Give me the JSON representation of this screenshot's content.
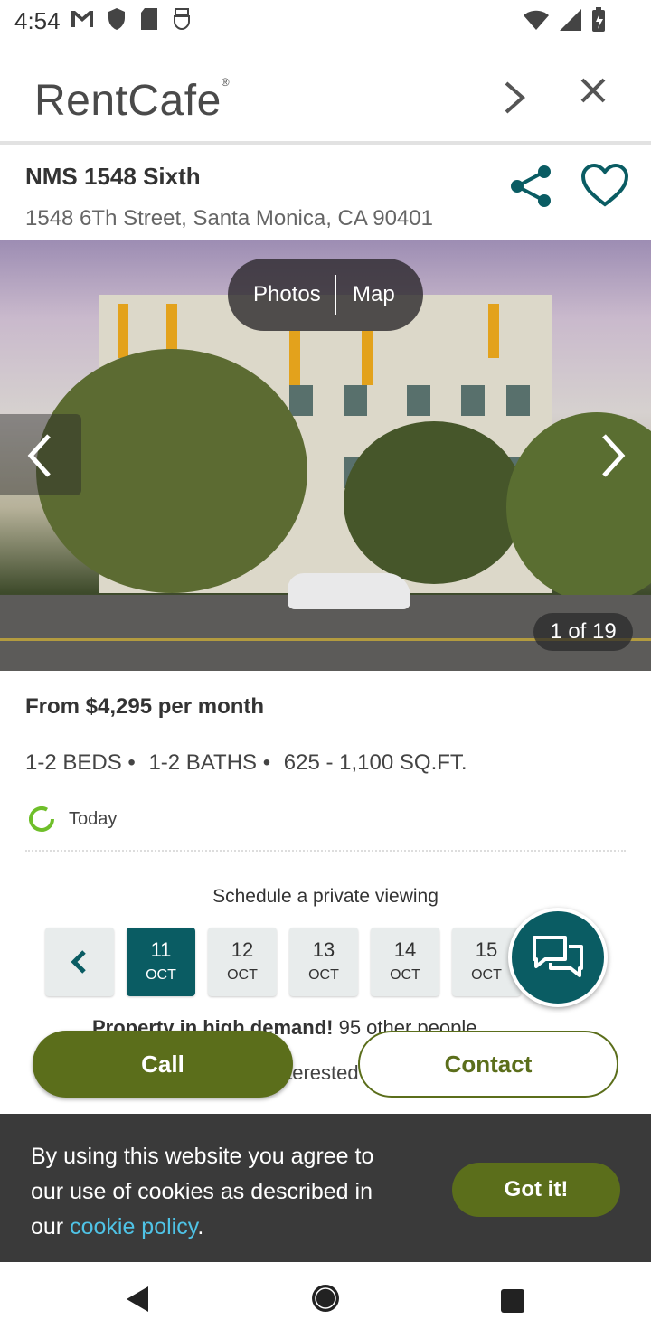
{
  "status_bar": {
    "time": "4:54",
    "icons_left": [
      "gmail-icon",
      "shield-icon",
      "sd-card-icon",
      "usb-icon"
    ],
    "icons_right": [
      "wifi-icon",
      "signal-icon",
      "battery-icon"
    ]
  },
  "brand": {
    "logo": "RentCafe",
    "logo_mark": "®"
  },
  "property": {
    "name": "NMS 1548 Sixth",
    "address": "1548 6Th Street, Santa Monica, CA 90401"
  },
  "photo": {
    "toggle_photos": "Photos",
    "toggle_map": "Map",
    "counter": "1 of 19"
  },
  "details": {
    "price": "From $4,295 per month",
    "beds": "1-2 BEDS •",
    "baths": "1-2 BATHS •",
    "sqft": "625 - 1,100 SQ.FT.",
    "updated": "Today"
  },
  "schedule": {
    "title": "Schedule a private viewing",
    "dates": [
      {
        "day": "11",
        "month": "OCT",
        "selected": true
      },
      {
        "day": "12",
        "month": "OCT",
        "selected": false
      },
      {
        "day": "13",
        "month": "OCT",
        "selected": false
      },
      {
        "day": "14",
        "month": "OCT",
        "selected": false
      },
      {
        "day": "15",
        "month": "OCT",
        "selected": false
      }
    ],
    "demand_text": "Property in high demand!",
    "demand_detail": "95 other people",
    "interested": "interested"
  },
  "actions": {
    "call": "Call",
    "contact": "Contact"
  },
  "cookie": {
    "text": "By using this website you agree to our use of cookies as described in our ",
    "link": "cookie policy",
    "period": ".",
    "button": "Got it!"
  },
  "colors": {
    "brand_green": "#5b6e1b",
    "teal": "#0a5c63",
    "link_blue": "#4fc3e6",
    "cookie_bg": "#3a3a3a"
  }
}
